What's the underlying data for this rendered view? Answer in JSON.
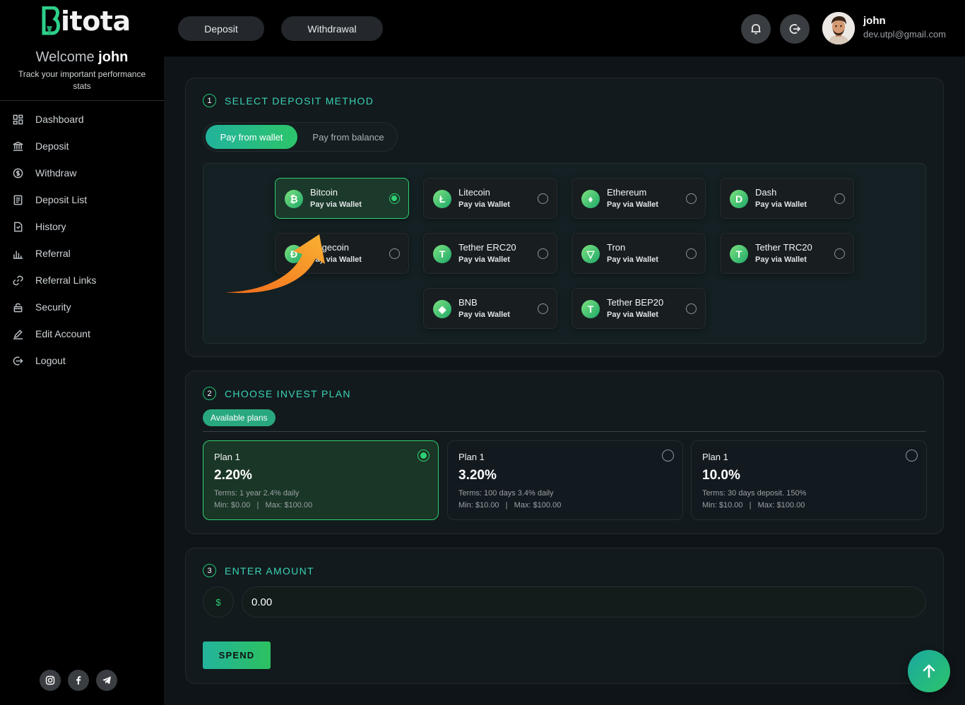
{
  "brand": {
    "logo_text": "itota",
    "logo_letter": "B"
  },
  "sidebar": {
    "welcome_prefix": "Welcome",
    "welcome_name": "john",
    "tagline": "Track your important performance stats",
    "items": [
      {
        "label": "Dashboard",
        "icon": "grid-icon"
      },
      {
        "label": "Deposit",
        "icon": "bank-icon"
      },
      {
        "label": "Withdraw",
        "icon": "dollar-circle-icon"
      },
      {
        "label": "Deposit List",
        "icon": "document-list-icon"
      },
      {
        "label": "History",
        "icon": "history-icon"
      },
      {
        "label": "Referral",
        "icon": "bar-chart-icon"
      },
      {
        "label": "Referral Links",
        "icon": "link-icon"
      },
      {
        "label": "Security",
        "icon": "lock-icon"
      },
      {
        "label": "Edit Account",
        "icon": "edit-icon"
      },
      {
        "label": "Logout",
        "icon": "logout-icon"
      }
    ],
    "socials": [
      "instagram-icon",
      "facebook-icon",
      "telegram-icon"
    ]
  },
  "topbar": {
    "deposit_label": "Deposit",
    "withdrawal_label": "Withdrawal",
    "user_name": "john",
    "user_email": "dev.utpl@gmail.com"
  },
  "deposit_method": {
    "step": "1",
    "title": "SELECT DEPOSIT METHOD",
    "tabs": [
      "Pay from wallet",
      "Pay from balance"
    ],
    "active_tab": "Pay from wallet",
    "methods": [
      {
        "name": "Bitcoin",
        "sub": "Pay via Wallet",
        "selected": true,
        "glyph": "₿"
      },
      {
        "name": "Litecoin",
        "sub": "Pay via Wallet",
        "selected": false,
        "glyph": "Ł"
      },
      {
        "name": "Ethereum",
        "sub": "Pay via Wallet",
        "selected": false,
        "glyph": "♦"
      },
      {
        "name": "Dash",
        "sub": "Pay via Wallet",
        "selected": false,
        "glyph": "D"
      },
      {
        "name": "Dogecoin",
        "sub": "Pay via Wallet",
        "selected": false,
        "glyph": "Ð"
      },
      {
        "name": "Tether ERC20",
        "sub": "Pay via Wallet",
        "selected": false,
        "glyph": "T"
      },
      {
        "name": "Tron",
        "sub": "Pay via Wallet",
        "selected": false,
        "glyph": "▽"
      },
      {
        "name": "Tether TRC20",
        "sub": "Pay via Wallet",
        "selected": false,
        "glyph": "T"
      },
      {
        "name": "BNB",
        "sub": "Pay via Wallet",
        "selected": false,
        "glyph": "◆"
      },
      {
        "name": "Tether BEP20",
        "sub": "Pay via Wallet",
        "selected": false,
        "glyph": "T"
      }
    ]
  },
  "invest_plan": {
    "step": "2",
    "title": "CHOOSE INVEST PLAN",
    "badge": "Available plans",
    "plans": [
      {
        "name": "Plan 1",
        "rate": "2.20%",
        "terms": "Terms: 1 year 2.4% daily",
        "limits": "Min: $0.00   |   Max: $100.00",
        "selected": true
      },
      {
        "name": "Plan 1",
        "rate": "3.20%",
        "terms": "Terms: 100 days 3.4% daily",
        "limits": "Min: $10.00   |   Max: $100.00",
        "selected": false
      },
      {
        "name": "Plan 1",
        "rate": "10.0%",
        "terms": "Terms: 30 days deposit. 150%",
        "limits": "Min: $10.00   |   Max: $100.00",
        "selected": false
      }
    ]
  },
  "amount": {
    "step": "3",
    "title": "ENTER AMOUNT",
    "currency_symbol": "$",
    "value": "0.00",
    "submit_label": "SPEND"
  },
  "colors": {
    "accent": "#2fcf73",
    "teal": "#3ad3b4",
    "annotation_arrow": "#f7941d"
  }
}
